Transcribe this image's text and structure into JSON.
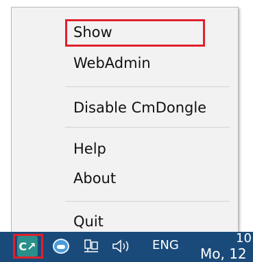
{
  "context_menu": {
    "items": [
      {
        "label": "Show"
      },
      {
        "label": "WebAdmin"
      },
      {
        "label": "Disable CmDongle"
      },
      {
        "label": "Help"
      },
      {
        "label": "About"
      },
      {
        "label": "Quit"
      }
    ]
  },
  "taskbar": {
    "language": "ENG",
    "clock_time": "10",
    "clock_date": "Mo, 12",
    "tray_icons": [
      "codemeter-icon",
      "dongle-icon",
      "network-icon",
      "volume-icon"
    ]
  },
  "colors": {
    "menu_bg": "#f2f2f2",
    "highlight": "#e0202c",
    "taskbar_bg": "#1a4a7a"
  }
}
